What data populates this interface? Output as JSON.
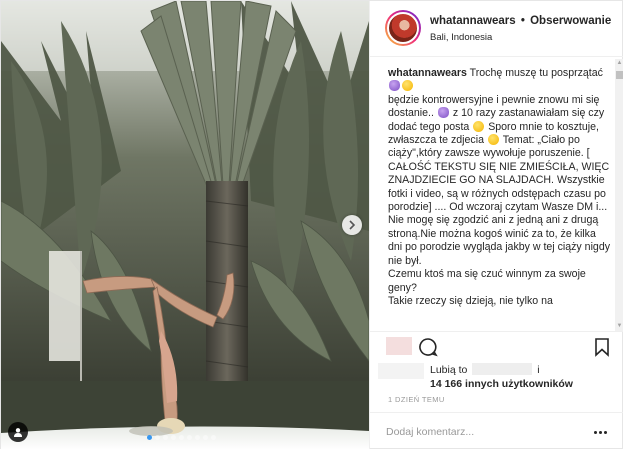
{
  "post": {
    "username": "whatannawears",
    "separator": "•",
    "follow_label": "Obserwowanie",
    "location": "Bali, Indonesia"
  },
  "caption": {
    "username": "whatannawears",
    "lines": [
      "Trochę muszę tu posprzątać",
      "będzie kontrowersyjne i pewnie znowu mi się dostanie..",
      "z 10 razy zastanawiałam się czy dodać tego posta",
      "Sporo mnie to kosztuje, zwłaszcza te zdjecia",
      "Temat: „Ciało po ciąży\",który zawsze wywołuje poruszenie. [ CAŁOŚĆ TEKSTU SIĘ NIE ZMIEŚCIŁA, WIĘC ZNAJDZIECIE GO NA SLAJDACH. Wszystkie fotki i video, są w różnych odstępach czasu po porodzie] .... Od wczoraj czytam Wasze DM i... Nie mogę się zgodzić ani z jedną ani z drugą stroną.Nie można kogoś winić za to, że kilka dni po porodzie wygląda jakby w tej ciąży nigdy nie był.",
      "Czemu ktoś ma się czuć winnym za swoje geny?",
      "Takie rzeczy się dzieją, nie tylko na"
    ]
  },
  "likes": {
    "prefix": "Lubią to",
    "connector": "i",
    "others": "14 166 innych użytkowników"
  },
  "timestamp": "1 DZIEŃ TEMU",
  "comment": {
    "placeholder": "Dodaj komentarz..."
  },
  "carousel": {
    "slide_count": 9,
    "active_index": 0
  },
  "icons": {
    "comment": "comment-bubble-icon",
    "save": "bookmark-icon",
    "next": "chevron-right-icon",
    "tag": "user-tag-icon",
    "more": "more-options-icon"
  },
  "colors": {
    "text": "#262626",
    "muted": "#999999",
    "accent": "#3897f0",
    "border": "#efefef"
  }
}
